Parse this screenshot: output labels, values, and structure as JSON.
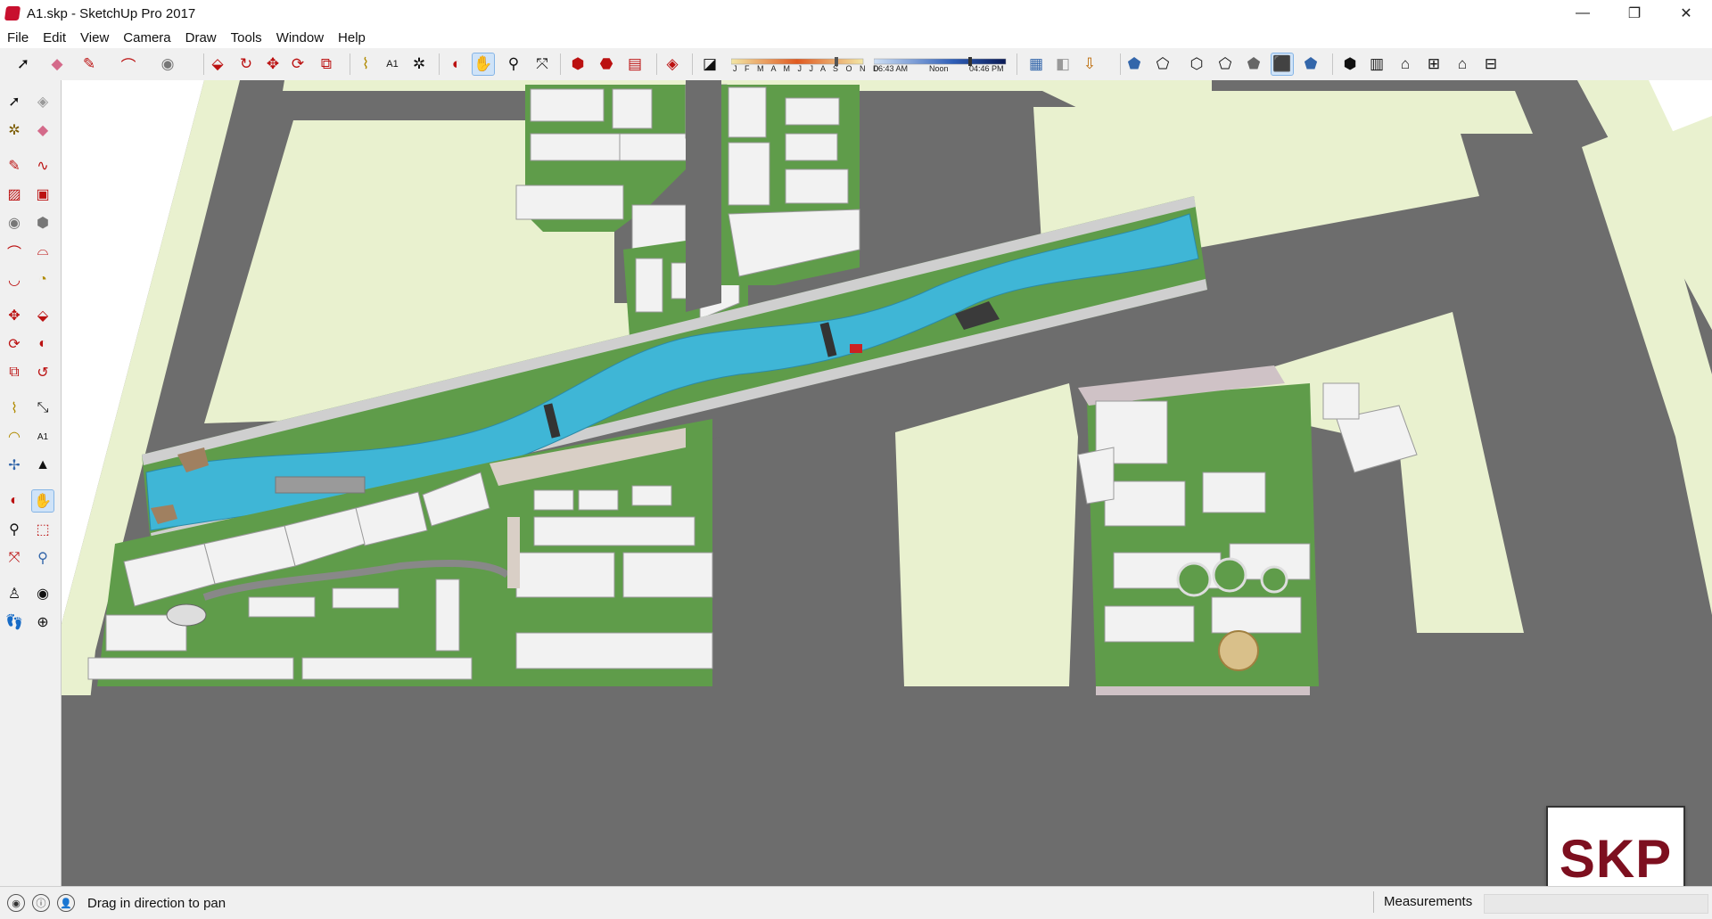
{
  "window": {
    "title": "A1.skp - SketchUp Pro 2017",
    "minimize_glyph": "—",
    "maximize_glyph": "❐",
    "close_glyph": "✕"
  },
  "menu": [
    "File",
    "Edit",
    "View",
    "Camera",
    "Draw",
    "Tools",
    "Window",
    "Help"
  ],
  "toolbar": {
    "icons": [
      "select-icon",
      "eraser-icon",
      "pencil-icon",
      "arc-icon",
      "circle-icon",
      "push-pull-icon",
      "follow-me-icon",
      "move-icon",
      "rotate-icon",
      "scale-icon",
      "tape-measure-icon",
      "text-icon",
      "paint-bucket-icon",
      "orbit-icon",
      "pan-icon",
      "zoom-icon",
      "zoom-extents-icon",
      "components-icon",
      "materials-icon",
      "styles-icon",
      "ruby-icon",
      "shadow-toggle-icon",
      "front-view-icon",
      "top-view-icon",
      "right-view-icon",
      "back-view-icon",
      "left-view-icon",
      "iso-view-icon",
      "x-ray-icon",
      "back-edges-icon",
      "wireframe-icon",
      "hidden-line-icon",
      "shaded-icon",
      "textured-icon",
      "monochrome-icon",
      "warehouse-icon",
      "extension-icon",
      "house-icon",
      "section-icon",
      "roof-icon",
      "plane-icon"
    ],
    "active": "pan-icon",
    "shadow_months": "J F M A M J J A S O N D",
    "shadow_time_start": "06:43 AM",
    "shadow_time_mid": "Noon",
    "shadow_time_end": "04:46 PM"
  },
  "left_tools": [
    "select-icon",
    "component-icon",
    "paint-bucket-icon",
    "eraser-icon",
    "line-icon",
    "freehand-icon",
    "rectangle-icon",
    "rotated-rectangle-icon",
    "circle-icon",
    "polygon-icon",
    "arc-icon",
    "two-point-arc-icon",
    "three-point-arc-icon",
    "pie-icon",
    "move-icon",
    "push-pull-icon",
    "rotate-icon",
    "follow-me-icon",
    "scale-icon",
    "offset-icon",
    "tape-measure-icon",
    "dimension-icon",
    "protractor-icon",
    "text-icon",
    "axes-icon",
    "3d-text-icon",
    "orbit-icon",
    "pan-icon",
    "zoom-icon",
    "zoom-window-icon",
    "zoom-extents-icon",
    "previous-view-icon",
    "position-camera-icon",
    "look-around-icon",
    "walk-icon",
    "section-plane-icon"
  ],
  "status": {
    "hint": "Drag in direction to pan",
    "measurements_label": "Measurements",
    "measurements_value": ""
  },
  "badge": {
    "text": "SKP"
  },
  "colors": {
    "road": "#6b6b6b",
    "lawn": "#e9f1cf",
    "grass": "#5f9c4a",
    "water": "#3fb6d6",
    "building": "#f2f2f2",
    "plaza": "#d9cfc6",
    "badge": "#7d0f1f"
  }
}
